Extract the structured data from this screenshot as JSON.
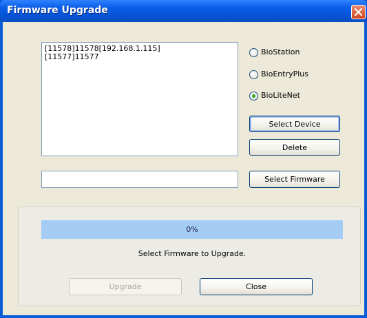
{
  "window": {
    "title": "Firmware Upgrade"
  },
  "device_list": {
    "items": [
      "[11578]11578[192.168.1.115]",
      "[11577]11577"
    ]
  },
  "device_types": {
    "options": [
      "BioStation",
      "BioEntryPlus",
      "BioLiteNet"
    ],
    "selected": "BioLiteNet"
  },
  "buttons": {
    "select_device": "Select Device",
    "delete": "Delete",
    "select_firmware": "Select Firmware",
    "upgrade": "Upgrade",
    "close": "Close"
  },
  "firmware_path": {
    "value": ""
  },
  "progress": {
    "text": "0%",
    "value": 0
  },
  "status": {
    "text": "Select Firmware to Upgrade."
  }
}
